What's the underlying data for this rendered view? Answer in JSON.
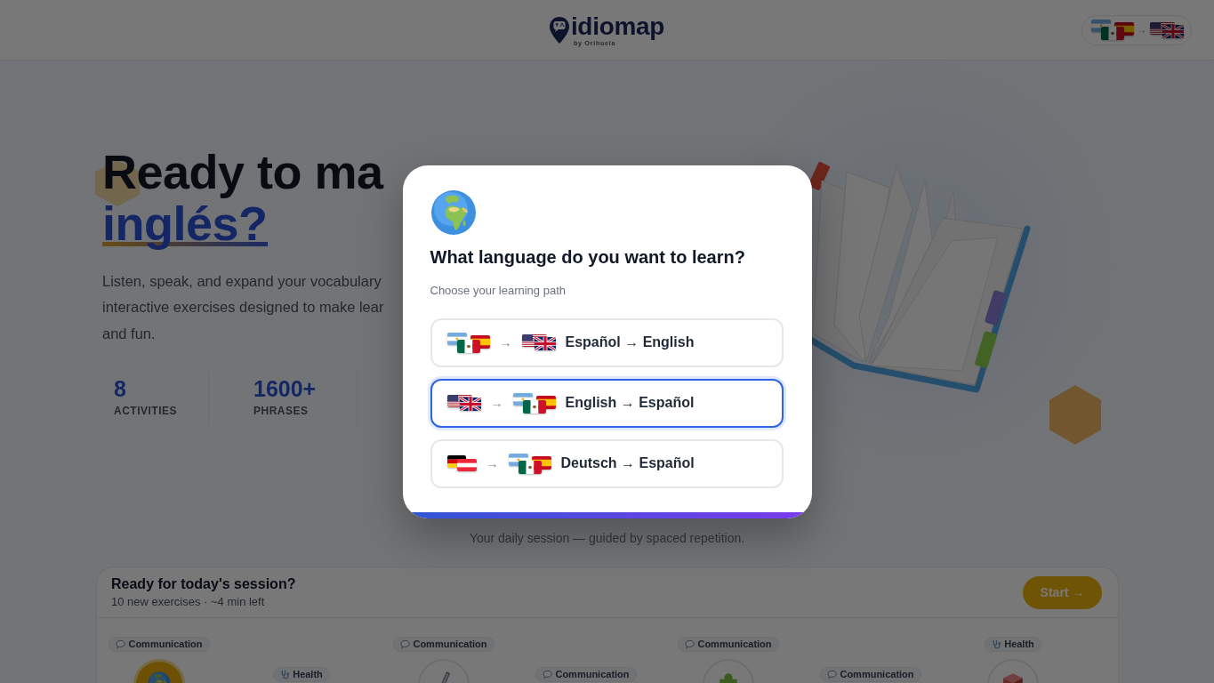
{
  "header": {
    "logo": {
      "name": "idiomap",
      "byline": "by Orihuela"
    },
    "language_switch": {
      "separator": "→"
    }
  },
  "hero": {
    "heading": "Ready to ma",
    "highlight": "inglés?",
    "description_lines": [
      "Listen, speak, and expand your vocabulary",
      "interactive exercises designed to make lear",
      "and fun."
    ],
    "stats": [
      {
        "value": "8",
        "label": "ACTIVITIES"
      },
      {
        "value": "1600+",
        "label": "PHRASES"
      }
    ]
  },
  "tagline": "Your daily session — guided by spaced repetition.",
  "session": {
    "title": "Ready for today's session?",
    "subtitle": "10 new exercises · ~4 min left",
    "start_button": "Start →",
    "steps": [
      {
        "kind": "communication",
        "category": "Communication",
        "node": {
          "current": true
        }
      },
      {
        "kind": "health",
        "category": "Health"
      },
      {
        "kind": "communication",
        "category": "Communication",
        "node": {
          "current": false
        }
      },
      {
        "kind": "communication",
        "category": "Communication"
      },
      {
        "kind": "communication",
        "category": "Communication",
        "node": {
          "current": false
        }
      },
      {
        "kind": "communication",
        "category": "Communication"
      },
      {
        "kind": "health",
        "category": "Health",
        "node": {
          "current": false
        }
      }
    ]
  },
  "modal": {
    "title": "What language do you want to learn?",
    "subtitle": "Choose your learning path",
    "options": [
      {
        "separator": "→",
        "label": "Español → English",
        "selected": false
      },
      {
        "separator": "→",
        "label": "English → Español",
        "selected": true
      },
      {
        "separator": "→",
        "label": "Deutsch → Español",
        "selected": false
      }
    ]
  }
}
